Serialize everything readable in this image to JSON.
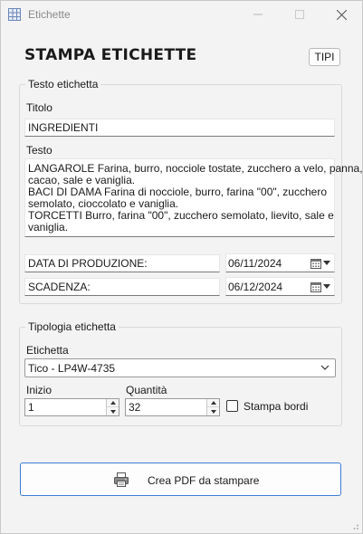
{
  "window": {
    "title": "Etichette",
    "app_icon": "grid-app-icon",
    "controls": [
      "minimize",
      "maximize",
      "close"
    ]
  },
  "heading": "STAMPA ETICHETTE",
  "tipi_button": "TIPI",
  "testo_group": {
    "legend": "Testo etichetta",
    "titolo_label": "Titolo",
    "titolo_value": "INGREDIENTI",
    "testo_label": "Testo",
    "testo_lines": [
      "LANGAROLE Farina, burro, nocciole tostate, zucchero a velo, panna,",
      "cacao, sale e vaniglia.",
      "BACI DI DAMA Farina di nocciole, burro, farina \"00\", zucchero",
      "semolato, cioccolato e vaniglia.",
      "TORCETTI Burro, farina \"00\", zucchero semolato, lievito, sale e",
      "vaniglia."
    ],
    "data_produzione_label": "DATA DI PRODUZIONE:",
    "data_produzione_value": "06/11/2024",
    "scadenza_label": "SCADENZA:",
    "scadenza_value": "06/12/2024"
  },
  "tipologia_group": {
    "legend": "Tipologia etichetta",
    "etichetta_label": "Etichetta",
    "etichetta_selected": "Tico - LP4W-4735",
    "inizio_label": "Inizio",
    "inizio_value": "1",
    "quantita_label": "Quantità",
    "quantita_value": "32",
    "stampa_bordi_label": "Stampa bordi",
    "stampa_bordi_checked": false
  },
  "create_button": {
    "label": "Crea PDF da stampare",
    "icon": "printer-icon"
  },
  "colors": {
    "window_bg": "#f3f3f3",
    "accent_border": "#3b7bd8"
  }
}
